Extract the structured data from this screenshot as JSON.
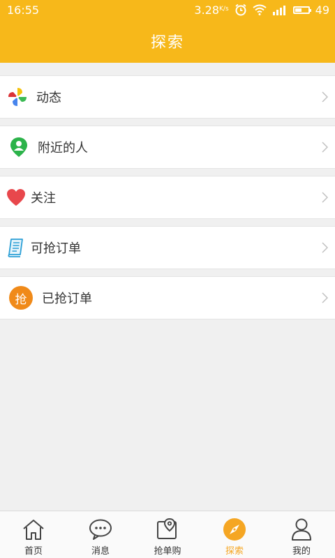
{
  "status_bar": {
    "time": "16:55",
    "speed": "3.28",
    "speed_unit": "K/s",
    "battery": "49"
  },
  "header": {
    "title": "探索"
  },
  "menu": {
    "items": [
      {
        "label": "动态",
        "icon": "pinwheel-icon"
      },
      {
        "label": "附近的人",
        "icon": "location-person-icon"
      },
      {
        "label": "关注",
        "icon": "heart-icon"
      },
      {
        "label": "可抢订单",
        "icon": "document-icon"
      },
      {
        "label": "已抢订单",
        "icon": "grab-badge-icon",
        "badge_text": "抢"
      }
    ]
  },
  "tab_bar": {
    "tabs": [
      {
        "label": "首页",
        "icon": "home-icon"
      },
      {
        "label": "消息",
        "icon": "chat-bubble-icon"
      },
      {
        "label": "抢单购",
        "icon": "map-pin-icon"
      },
      {
        "label": "探索",
        "icon": "compass-icon",
        "active": true
      },
      {
        "label": "我的",
        "icon": "user-icon"
      }
    ]
  },
  "colors": {
    "brand": "#f7b81a",
    "active_tab": "#f5a623",
    "background": "#f0f0f0"
  }
}
